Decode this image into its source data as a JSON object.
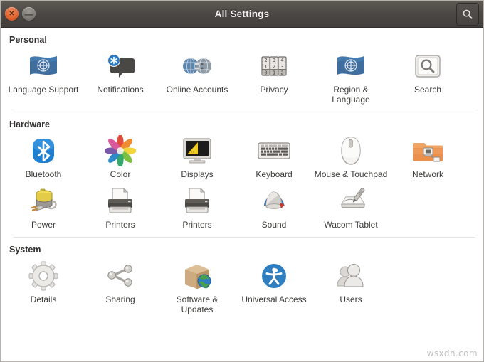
{
  "window": {
    "title": "All Settings",
    "close_label": "✕",
    "minimize_label": "—",
    "search_icon_name": "search-icon",
    "accent_close_color": "#e0602b",
    "titlebar_color": "#4b4744"
  },
  "watermark": "wsxdn.com",
  "sections": [
    {
      "title": "Personal",
      "items": [
        {
          "label": "Language Support",
          "icon": "flag-icon"
        },
        {
          "label": "Notifications",
          "icon": "speech-bubble-icon"
        },
        {
          "label": "Online Accounts",
          "icon": "globe-connect-icon"
        },
        {
          "label": "Privacy",
          "icon": "combination-lock-icon"
        },
        {
          "label": "Region & Language",
          "icon": "flag-icon"
        },
        {
          "label": "Search",
          "icon": "magnifier-box-icon"
        }
      ]
    },
    {
      "title": "Hardware",
      "items": [
        {
          "label": "Bluetooth",
          "icon": "bluetooth-icon"
        },
        {
          "label": "Color",
          "icon": "color-flower-icon"
        },
        {
          "label": "Displays",
          "icon": "monitor-icon"
        },
        {
          "label": "Keyboard",
          "icon": "keyboard-icon"
        },
        {
          "label": "Mouse & Touchpad",
          "icon": "mouse-icon"
        },
        {
          "label": "Network",
          "icon": "network-folder-icon"
        },
        {
          "label": "Power",
          "icon": "battery-plug-icon"
        },
        {
          "label": "Printers",
          "icon": "printer-icon"
        },
        {
          "label": "Printers",
          "icon": "printer-icon"
        },
        {
          "label": "Sound",
          "icon": "speaker-icon"
        },
        {
          "label": "Wacom Tablet",
          "icon": "tablet-stylus-icon"
        }
      ]
    },
    {
      "title": "System",
      "items": [
        {
          "label": "Details",
          "icon": "gear-icon"
        },
        {
          "label": "Sharing",
          "icon": "share-nodes-icon"
        },
        {
          "label": "Software & Updates",
          "icon": "box-globe-icon"
        },
        {
          "label": "Universal Access",
          "icon": "accessibility-icon"
        },
        {
          "label": "Users",
          "icon": "users-icon"
        }
      ]
    }
  ]
}
